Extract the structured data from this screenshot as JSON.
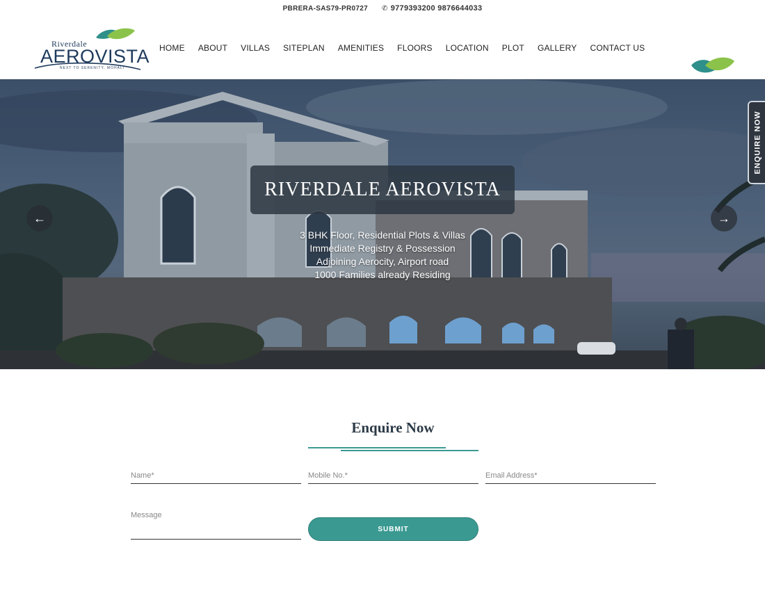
{
  "topbar": {
    "rera": "PBRERA-SAS79-PR0727",
    "phone_icon": "phone-icon",
    "phone": "9779393200  9876644033"
  },
  "brand": {
    "name_small": "Riverdale",
    "name_big": "AEROVISTA",
    "tagline": "NEXT TO SERENITY, MOHALI",
    "colors": {
      "navy": "#1e3a5c",
      "teal": "#3a9a92",
      "leaf_green": "#8bc34a"
    }
  },
  "nav": {
    "items": [
      "HOME",
      "ABOUT",
      "VILLAS",
      "SITEPLAN",
      "AMENITIES",
      "FLOORS",
      "LOCATION",
      "PLOT",
      "GALLERY",
      "CONTACT US"
    ]
  },
  "hero": {
    "title": "RIVERDALE AEROVISTA",
    "lines": [
      "3 BHK Floor, Residential Plots & Villas",
      "Immediate Registry & Possession",
      "Adjoining Aerocity, Airport road",
      "1000 Families already Residing"
    ],
    "prev_icon": "arrow-left-icon",
    "next_icon": "arrow-right-icon"
  },
  "side_tab": {
    "label": "ENQUIRE NOW"
  },
  "form": {
    "title": "Enquire Now",
    "name_placeholder": "Name*",
    "mobile_placeholder": "Mobile No.*",
    "email_placeholder": "Email Address*",
    "message_placeholder": "Message",
    "submit_label": "SUBMIT"
  }
}
